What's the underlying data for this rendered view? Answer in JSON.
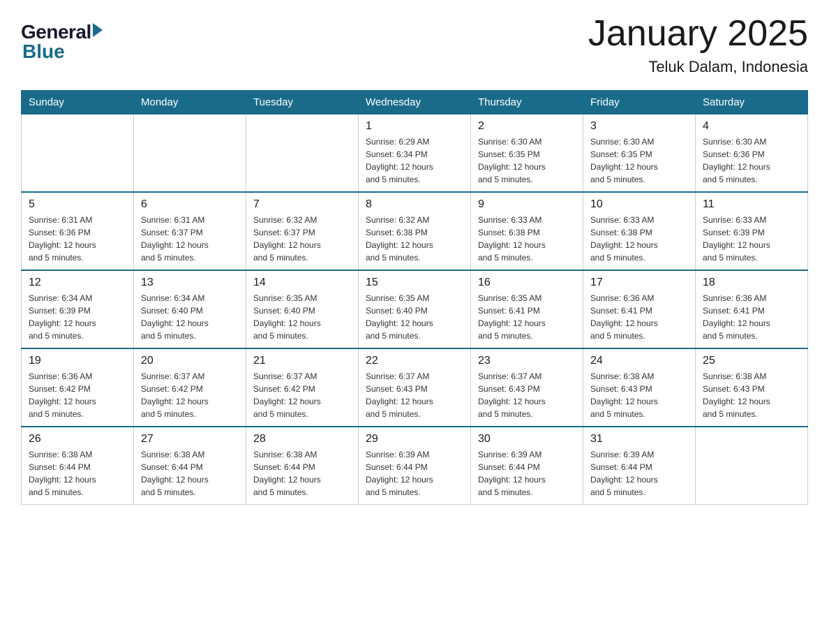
{
  "header": {
    "logo_general": "General",
    "logo_blue": "Blue",
    "title": "January 2025",
    "subtitle": "Teluk Dalam, Indonesia"
  },
  "days_of_week": [
    "Sunday",
    "Monday",
    "Tuesday",
    "Wednesday",
    "Thursday",
    "Friday",
    "Saturday"
  ],
  "weeks": [
    [
      {
        "day": "",
        "info": ""
      },
      {
        "day": "",
        "info": ""
      },
      {
        "day": "",
        "info": ""
      },
      {
        "day": "1",
        "info": "Sunrise: 6:29 AM\nSunset: 6:34 PM\nDaylight: 12 hours\nand 5 minutes."
      },
      {
        "day": "2",
        "info": "Sunrise: 6:30 AM\nSunset: 6:35 PM\nDaylight: 12 hours\nand 5 minutes."
      },
      {
        "day": "3",
        "info": "Sunrise: 6:30 AM\nSunset: 6:35 PM\nDaylight: 12 hours\nand 5 minutes."
      },
      {
        "day": "4",
        "info": "Sunrise: 6:30 AM\nSunset: 6:36 PM\nDaylight: 12 hours\nand 5 minutes."
      }
    ],
    [
      {
        "day": "5",
        "info": "Sunrise: 6:31 AM\nSunset: 6:36 PM\nDaylight: 12 hours\nand 5 minutes."
      },
      {
        "day": "6",
        "info": "Sunrise: 6:31 AM\nSunset: 6:37 PM\nDaylight: 12 hours\nand 5 minutes."
      },
      {
        "day": "7",
        "info": "Sunrise: 6:32 AM\nSunset: 6:37 PM\nDaylight: 12 hours\nand 5 minutes."
      },
      {
        "day": "8",
        "info": "Sunrise: 6:32 AM\nSunset: 6:38 PM\nDaylight: 12 hours\nand 5 minutes."
      },
      {
        "day": "9",
        "info": "Sunrise: 6:33 AM\nSunset: 6:38 PM\nDaylight: 12 hours\nand 5 minutes."
      },
      {
        "day": "10",
        "info": "Sunrise: 6:33 AM\nSunset: 6:38 PM\nDaylight: 12 hours\nand 5 minutes."
      },
      {
        "day": "11",
        "info": "Sunrise: 6:33 AM\nSunset: 6:39 PM\nDaylight: 12 hours\nand 5 minutes."
      }
    ],
    [
      {
        "day": "12",
        "info": "Sunrise: 6:34 AM\nSunset: 6:39 PM\nDaylight: 12 hours\nand 5 minutes."
      },
      {
        "day": "13",
        "info": "Sunrise: 6:34 AM\nSunset: 6:40 PM\nDaylight: 12 hours\nand 5 minutes."
      },
      {
        "day": "14",
        "info": "Sunrise: 6:35 AM\nSunset: 6:40 PM\nDaylight: 12 hours\nand 5 minutes."
      },
      {
        "day": "15",
        "info": "Sunrise: 6:35 AM\nSunset: 6:40 PM\nDaylight: 12 hours\nand 5 minutes."
      },
      {
        "day": "16",
        "info": "Sunrise: 6:35 AM\nSunset: 6:41 PM\nDaylight: 12 hours\nand 5 minutes."
      },
      {
        "day": "17",
        "info": "Sunrise: 6:36 AM\nSunset: 6:41 PM\nDaylight: 12 hours\nand 5 minutes."
      },
      {
        "day": "18",
        "info": "Sunrise: 6:36 AM\nSunset: 6:41 PM\nDaylight: 12 hours\nand 5 minutes."
      }
    ],
    [
      {
        "day": "19",
        "info": "Sunrise: 6:36 AM\nSunset: 6:42 PM\nDaylight: 12 hours\nand 5 minutes."
      },
      {
        "day": "20",
        "info": "Sunrise: 6:37 AM\nSunset: 6:42 PM\nDaylight: 12 hours\nand 5 minutes."
      },
      {
        "day": "21",
        "info": "Sunrise: 6:37 AM\nSunset: 6:42 PM\nDaylight: 12 hours\nand 5 minutes."
      },
      {
        "day": "22",
        "info": "Sunrise: 6:37 AM\nSunset: 6:43 PM\nDaylight: 12 hours\nand 5 minutes."
      },
      {
        "day": "23",
        "info": "Sunrise: 6:37 AM\nSunset: 6:43 PM\nDaylight: 12 hours\nand 5 minutes."
      },
      {
        "day": "24",
        "info": "Sunrise: 6:38 AM\nSunset: 6:43 PM\nDaylight: 12 hours\nand 5 minutes."
      },
      {
        "day": "25",
        "info": "Sunrise: 6:38 AM\nSunset: 6:43 PM\nDaylight: 12 hours\nand 5 minutes."
      }
    ],
    [
      {
        "day": "26",
        "info": "Sunrise: 6:38 AM\nSunset: 6:44 PM\nDaylight: 12 hours\nand 5 minutes."
      },
      {
        "day": "27",
        "info": "Sunrise: 6:38 AM\nSunset: 6:44 PM\nDaylight: 12 hours\nand 5 minutes."
      },
      {
        "day": "28",
        "info": "Sunrise: 6:38 AM\nSunset: 6:44 PM\nDaylight: 12 hours\nand 5 minutes."
      },
      {
        "day": "29",
        "info": "Sunrise: 6:39 AM\nSunset: 6:44 PM\nDaylight: 12 hours\nand 5 minutes."
      },
      {
        "day": "30",
        "info": "Sunrise: 6:39 AM\nSunset: 6:44 PM\nDaylight: 12 hours\nand 5 minutes."
      },
      {
        "day": "31",
        "info": "Sunrise: 6:39 AM\nSunset: 6:44 PM\nDaylight: 12 hours\nand 5 minutes."
      },
      {
        "day": "",
        "info": ""
      }
    ]
  ]
}
